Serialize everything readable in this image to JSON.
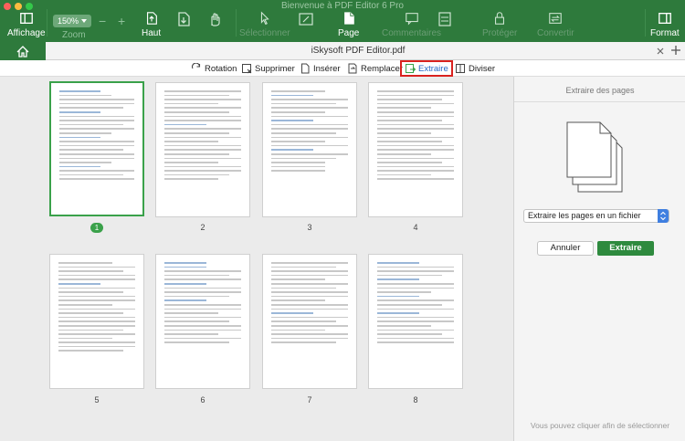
{
  "window": {
    "title": "Bienvenue à PDF Editor 6 Pro"
  },
  "toolbar": {
    "affichage_label": "Affichage",
    "zoom_value": "150%",
    "zoom_label": "Zoom",
    "haut_label": "Haut",
    "page_label": "Page",
    "format_label": "Format",
    "dim_labels": [
      "Sélectionner",
      "Commentaires",
      "Protéger",
      "Convertir"
    ]
  },
  "tabs": {
    "document_title": "iSkysoft PDF Editor.pdf"
  },
  "actions": {
    "rotation": "Rotation",
    "supprimer": "Supprimer",
    "inserer": "Insérer",
    "remplacer": "Remplacer",
    "extraire": "Extraire",
    "diviser": "Diviser"
  },
  "pages": [
    {
      "number": "1",
      "selected": true
    },
    {
      "number": "2",
      "selected": false
    },
    {
      "number": "3",
      "selected": false
    },
    {
      "number": "4",
      "selected": false
    },
    {
      "number": "5",
      "selected": false
    },
    {
      "number": "6",
      "selected": false
    },
    {
      "number": "7",
      "selected": false
    },
    {
      "number": "8",
      "selected": false
    }
  ],
  "panel": {
    "title": "Extraire des pages",
    "select_value": "Extraire les pages en un fichier",
    "cancel_label": "Annuler",
    "extract_label": "Extraire",
    "hint": "Vous pouvez cliquer afin de sélectionner"
  },
  "colors": {
    "brand_green": "#2e7a3c",
    "highlight_red": "#d9221f",
    "active_blue": "#2569c8"
  }
}
